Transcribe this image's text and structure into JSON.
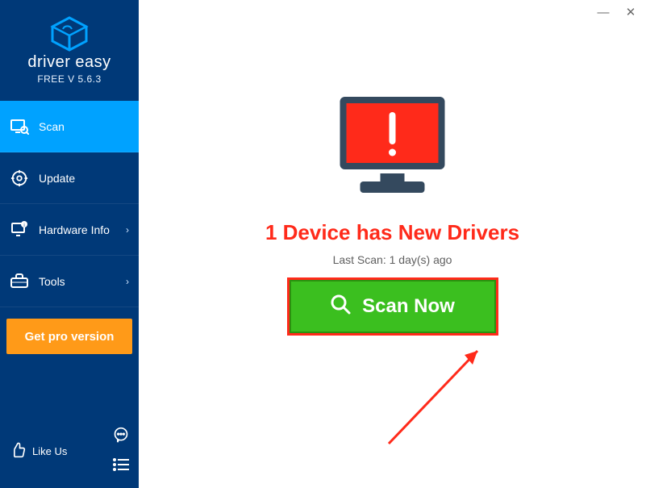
{
  "brand": {
    "name": "driver easy",
    "version": "FREE V 5.6.3"
  },
  "sidebar": {
    "items": [
      {
        "label": "Scan",
        "icon": "scan"
      },
      {
        "label": "Update",
        "icon": "update"
      },
      {
        "label": "Hardware Info",
        "icon": "hardware",
        "chevron": true
      },
      {
        "label": "Tools",
        "icon": "tools",
        "chevron": true
      }
    ],
    "pro_label": "Get pro version",
    "like_label": "Like Us"
  },
  "titlebar": {
    "minimize": "—",
    "close": "✕"
  },
  "main": {
    "headline": "1 Device has New Drivers",
    "last_scan": "Last Scan: 1 day(s) ago",
    "scan_label": "Scan Now"
  }
}
